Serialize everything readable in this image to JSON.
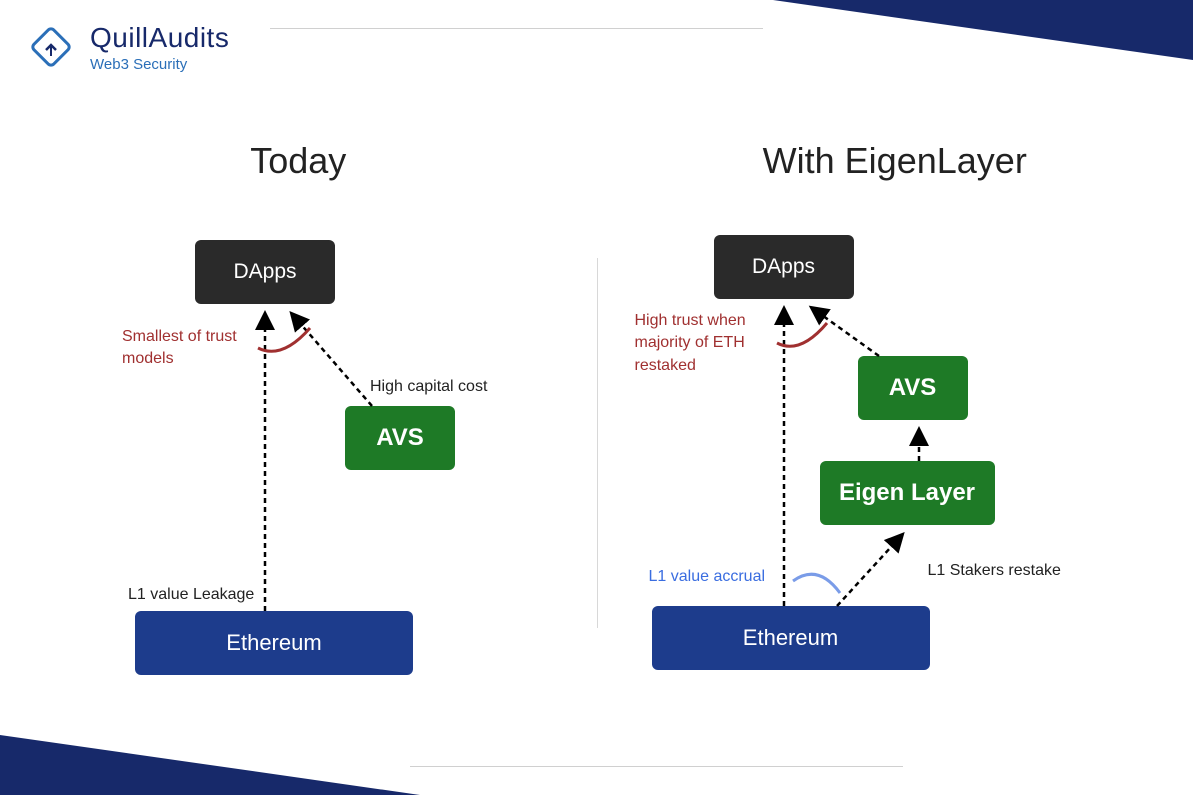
{
  "brand": {
    "name": "QuillAudits",
    "tagline": "Web3 Security"
  },
  "left": {
    "title": "Today",
    "box_dapps": "DApps",
    "box_avs": "AVS",
    "box_eth": "Ethereum",
    "ann_trust": "Smallest of trust models",
    "ann_cost": "High capital cost",
    "ann_leak": "L1 value Leakage"
  },
  "right": {
    "title": "With EigenLayer",
    "box_dapps": "DApps",
    "box_avs": "AVS",
    "box_eigen": "Eigen Layer",
    "box_eth": "Ethereum",
    "ann_trust": "High trust when majority of ETH restaked",
    "ann_accrual": "L1 value accrual",
    "ann_restake": "L1 Stakers restake"
  },
  "colors": {
    "navy": "#17296a",
    "eth_blue": "#1d3c8c",
    "green": "#1e7a26",
    "dark": "#2a2a2a",
    "red_text": "#a03030",
    "blue_text": "#3a6de0"
  }
}
